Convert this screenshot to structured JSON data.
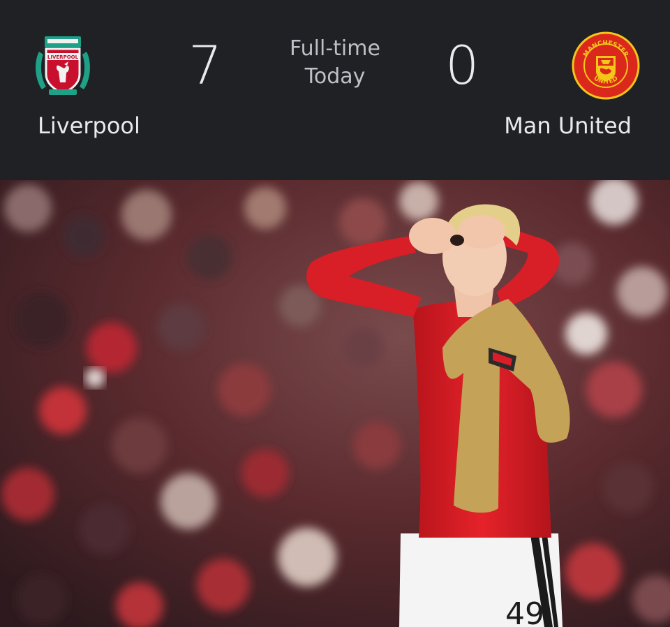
{
  "match": {
    "home_team": {
      "name": "Liverpool",
      "score": "7",
      "crest_icon": "liverpool-crest-icon",
      "crest_text": "LIVERPOOL",
      "color": "#c8102e"
    },
    "away_team": {
      "name": "Man United",
      "score": "0",
      "crest_icon": "manchester-united-crest-icon",
      "crest_text_top": "MANCHESTER",
      "crest_text_bottom": "UNITED",
      "color": "#da291c"
    },
    "status_line1": "Full-time",
    "status_line2": "Today"
  },
  "photo": {
    "subject": "player-celebration-photo",
    "shirt_number": "49",
    "colors": {
      "shirt": "#e01f26",
      "shorts": "#f4f4f4",
      "towel": "#c4a257",
      "crowd": "#5a2a2e"
    }
  },
  "theme": {
    "background": "#202124",
    "text_primary": "#e8eaed",
    "text_secondary": "#bdc1c6"
  }
}
